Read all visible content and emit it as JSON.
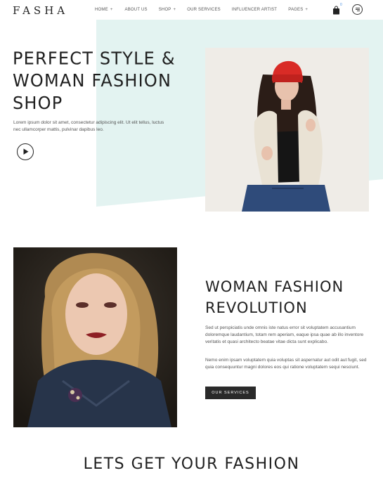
{
  "brand": {
    "logo": "FASHA"
  },
  "nav": {
    "items": [
      {
        "label": "HOME",
        "suffix": "+"
      },
      {
        "label": "ABOUT US",
        "suffix": ""
      },
      {
        "label": "SHOP",
        "suffix": "+"
      },
      {
        "label": "OUR SERVICES",
        "suffix": ""
      },
      {
        "label": "INFLUENCER ARTIST",
        "suffix": ""
      },
      {
        "label": "PAGES",
        "suffix": "+"
      }
    ],
    "cart_count": "0",
    "icons": [
      "shopping-bag-icon",
      "hamburger-menu-icon"
    ]
  },
  "hero": {
    "title_lines": [
      "PERFECT STYLE &",
      "WOMAN FASHION",
      "SHOP"
    ],
    "text": "Lorem ipsum dolor sit amet, consectetur adipiscing elit. Ut elit tellus, luctus nec ullamcorper mattis, pulvinar dapibus leo.",
    "play_icon": "play-icon",
    "accent_bg": "#e3f3f1"
  },
  "revolution": {
    "title_lines": [
      "WOMAN FASHION",
      "REVOLUTION"
    ],
    "paragraph_1": "Sed ut perspiciatis unde omnis iste natus error sit voluptatem accusantium doloremque laudantium, totam rem aperiam, eaque ipsa quae ab illo inventore veritatis et quasi architecto beatae vitae dicta sunt explicabo.",
    "paragraph_2": "Nemo enim ipsam voluptatem quia voluptas sit aspernatur aut odit aut fugit, sed quia consequuntur magni dolores eos qui ratione voluptatem sequi nesciunt.",
    "button_label": "OUR SERVICES"
  },
  "next_section": {
    "title": "LETS GET YOUR FASHION"
  }
}
